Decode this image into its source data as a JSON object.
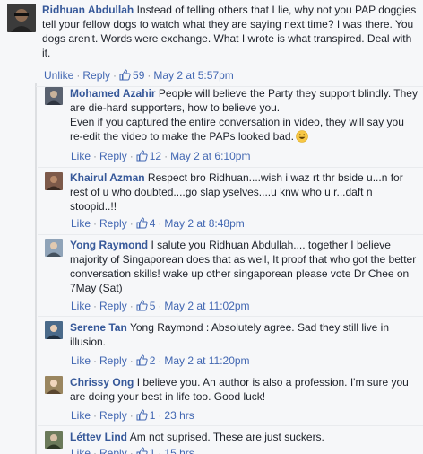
{
  "comments": [
    {
      "author": "Ridhuan Abdullah",
      "text": "Instead of telling others that I lie, why not you PAP doggies tell your fellow dogs to watch what they are saying next time? I was there. You dogs aren't. Words were exchange. What I wrote is what transpired. Deal with it.",
      "action1": "Unlike",
      "action2": "Reply",
      "likes": "59",
      "time": "May 2 at 5:57pm",
      "avatar_color": "#3b3b3b"
    },
    {
      "author": "Mohamed Azahir",
      "text": "People will believe the Party they support blindly. They are die-hard supporters, how to believe you.",
      "text2": "Even if you captured the entire conversation in video, they will say you re-edit the video to make the PAPs looked bad.",
      "action1": "Like",
      "action2": "Reply",
      "likes": "12",
      "time": "May 2 at 6:10pm",
      "avatar_color": "#5a6270",
      "emoji": "grinning-face-icon"
    },
    {
      "author": "Khairul Azman",
      "text": "Respect bro Ridhuan....wish i waz rt thr bside u...n for rest of u who doubted....go slap yselves....u knw who u r...daft n stoopid..!!",
      "action1": "Like",
      "action2": "Reply",
      "likes": "4",
      "time": "May 2 at 8:48pm",
      "avatar_color": "#7d5a4a"
    },
    {
      "author": "Yong Raymond",
      "text": "I salute you Ridhuan Abdullah.... together I believe majority of Singaporean does that as well, It proof that who got the better conversation skills! wake up other singaporean please vote Dr Chee on 7May (Sat)",
      "action1": "Like",
      "action2": "Reply",
      "likes": "5",
      "time": "May 2 at 11:02pm",
      "avatar_color": "#8fa3b8"
    },
    {
      "author": "Serene Tan",
      "text": "Yong Raymond : Absolutely agree. Sad they still live in illusion.",
      "action1": "Like",
      "action2": "Reply",
      "likes": "2",
      "time": "May 2 at 11:20pm",
      "avatar_color": "#4a6a8a"
    },
    {
      "author": "Chrissy Ong",
      "text": "I believe you. An author is also a profession. I'm sure you are doing your best in life too. Good luck!",
      "action1": "Like",
      "action2": "Reply",
      "likes": "1",
      "time": "23 hrs",
      "avatar_color": "#9a8660"
    },
    {
      "author": "Léttev Lind",
      "text": "Am not suprised. These are just suckers.",
      "action1": "Like",
      "action2": "Reply",
      "likes": "1",
      "time": "15 hrs",
      "avatar_color": "#6b7a5a"
    }
  ]
}
